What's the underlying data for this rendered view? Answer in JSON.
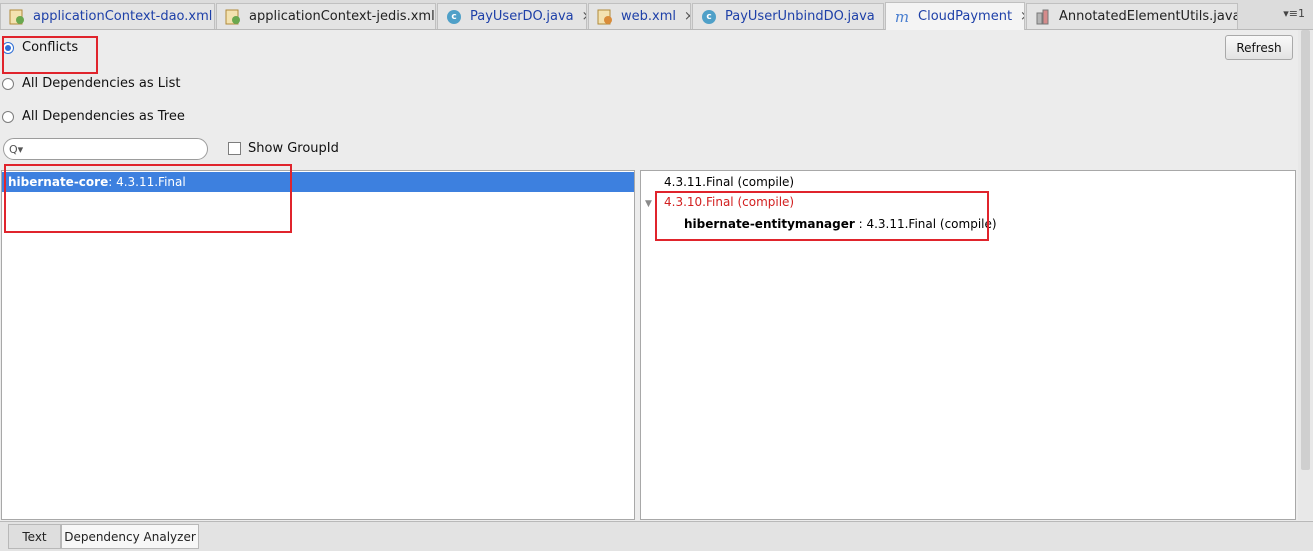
{
  "tabs": [
    {
      "label": "applicationContext-dao.xml",
      "icon": "xml-spring-icon",
      "close": "×"
    },
    {
      "label": "applicationContext-jedis.xml",
      "icon": "xml-spring-icon",
      "close": "×"
    },
    {
      "label": "PayUserDO.java",
      "icon": "java-class-icon",
      "close": "×"
    },
    {
      "label": "web.xml",
      "icon": "xml-file-icon",
      "close": "×"
    },
    {
      "label": "PayUserUnbindDO.java",
      "icon": "java-class-icon",
      "close": "×"
    },
    {
      "label": "CloudPayment",
      "icon": "maven-icon",
      "close": "×"
    },
    {
      "label": "AnnotatedElementUtils.java",
      "icon": "java-library-icon",
      "close": "×"
    }
  ],
  "tab_menu": "▾≡1",
  "options": {
    "conflicts": "Conflicts",
    "as_list": "All Dependencies as List",
    "as_tree": "All Dependencies as Tree",
    "selected": "conflicts"
  },
  "refresh_label": "Refresh",
  "search": {
    "placeholder": "",
    "icon": "Q▾"
  },
  "show_groupid": "Show GroupId",
  "left_list": [
    {
      "artifact": "hibernate-core",
      "version": " : 4.3.11.Final"
    }
  ],
  "right_tree": {
    "resolved": "4.3.11.Final (compile)",
    "conflict": "4.3.10.Final (compile)",
    "child_artifact": "hibernate-entitymanager",
    "child_version": " : 4.3.11.Final (compile)"
  },
  "bottom_tabs": {
    "text": "Text",
    "analyzer": "Dependency Analyzer"
  },
  "colors": {
    "selection": "#3d80df",
    "conflict": "#d21f1f",
    "highlight": "#e0242c"
  }
}
